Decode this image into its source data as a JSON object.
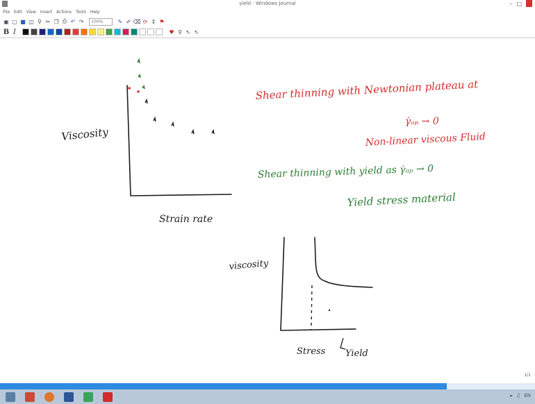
{
  "window": {
    "title": "yield - Windows Journal"
  },
  "menu": [
    "File",
    "Edit",
    "View",
    "Insert",
    "Actions",
    "Tools",
    "Help"
  ],
  "toolbar": {
    "icons": [
      "new-icon",
      "open-icon",
      "save-icon",
      "print-icon",
      "find-icon",
      "cut-icon",
      "copy-icon",
      "paste-icon",
      "undo-icon",
      "redo-icon"
    ],
    "zoom_value": "100%",
    "pen_icons": [
      "pen-icon",
      "highlighter-icon",
      "eraser-icon",
      "lasso-icon",
      "insert-space-icon",
      "flag-icon"
    ]
  },
  "format_bar": {
    "bold": "B",
    "italic": "I",
    "swatches": [
      "#111111",
      "#444444",
      "#1a237e",
      "#1565c0",
      "#0d47a1",
      "#b71c1c",
      "#e53935",
      "#ff6f00",
      "#fdd835",
      "#fff176",
      "#43a047",
      "#00bcd4",
      "#d81b60",
      "#00897b",
      "#ffffff",
      "#ffffff",
      "#ffffff"
    ]
  },
  "notes": {
    "graph1": {
      "ylabel": "Viscosity",
      "xlabel": "Strain rate"
    },
    "graph2": {
      "ylabel": "viscosity",
      "xlabel": "Stress",
      "marker": "Yield"
    },
    "red_line1": "Shear thinning with Newtonian plateau at",
    "red_line2": "γ̇ₐₚ → 0",
    "red_line3": "Non-linear viscous Fluid",
    "green_line1": "Shear thinning with yield as γ̇ₐₚ → 0",
    "green_line2": "Yield stress material"
  },
  "colors": {
    "ink_black": "#1c1c1c",
    "ink_red": "#d32f2f",
    "ink_green": "#2e7d32",
    "accent_blue": "#2d8ae0"
  },
  "page_indicator": "1/1",
  "progress": {
    "fill_fraction": 0.835
  },
  "taskbar_icons": [
    "start-icon",
    "file-explorer-icon",
    "browser-icon",
    "word-icon",
    "journal-icon",
    "acrobat-icon"
  ],
  "tray": {
    "text": "EN"
  }
}
